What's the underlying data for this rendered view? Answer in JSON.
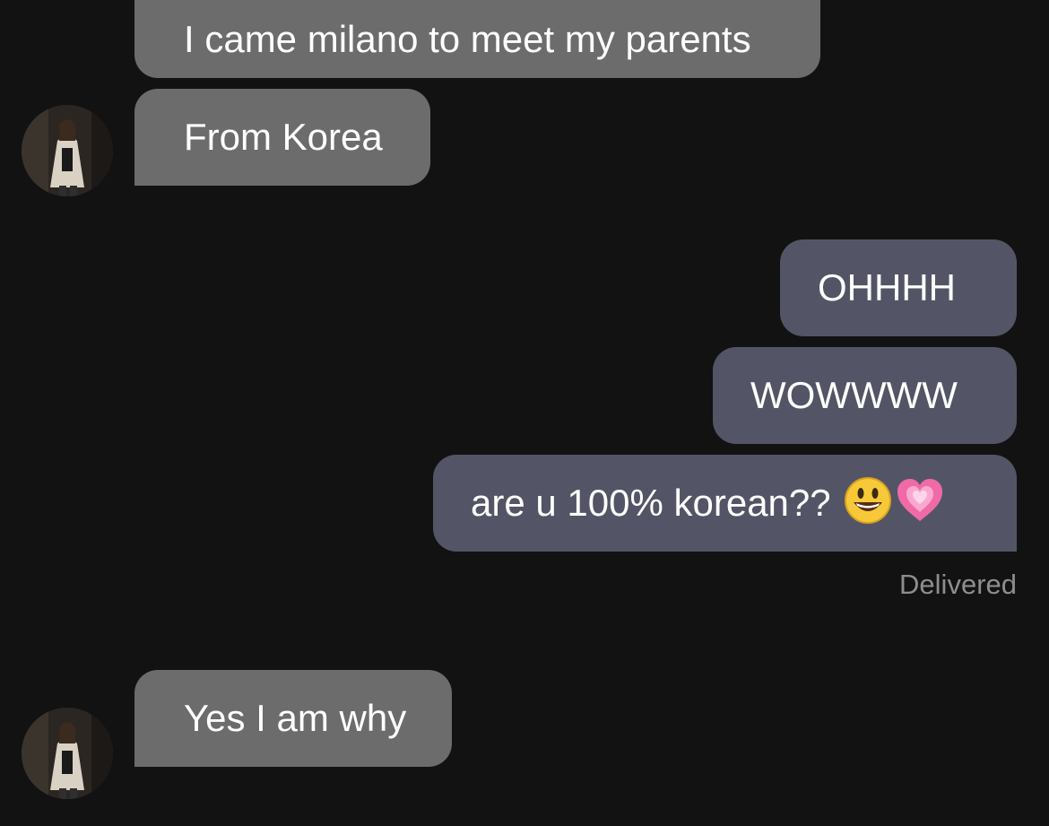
{
  "messages": [
    {
      "side": "received",
      "text": "I came milano to meet my parents"
    },
    {
      "side": "received",
      "text": "From Korea"
    },
    {
      "side": "sent",
      "text": "OHHHH"
    },
    {
      "side": "sent",
      "text": "WOWWWW"
    },
    {
      "side": "sent",
      "text": "are u 100% korean??",
      "emojis": [
        "grinning-face-emoji",
        "growing-heart-emoji"
      ]
    },
    {
      "side": "received",
      "text": "Yes I am why"
    }
  ],
  "status": {
    "delivered": "Delivered"
  },
  "colors": {
    "background": "#121212",
    "received_bubble": "#6c6c6c",
    "sent_bubble": "#535566",
    "status_text": "#8e8e8e"
  }
}
